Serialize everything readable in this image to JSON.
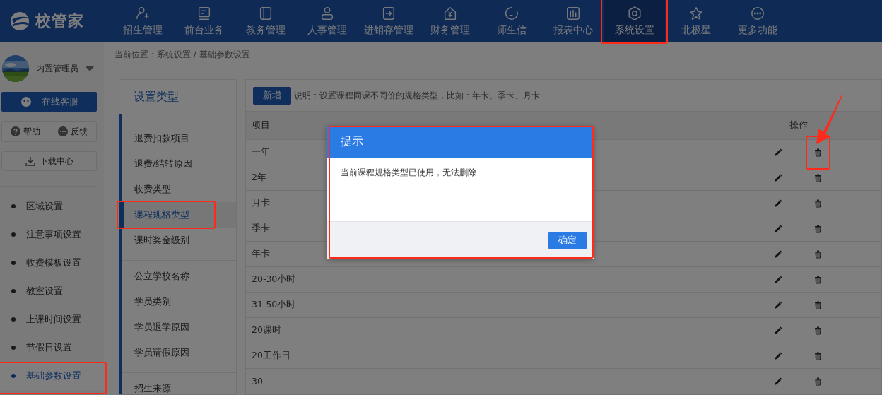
{
  "logo": {
    "text": "校管家"
  },
  "nav": [
    {
      "label": "招生管理",
      "selected": false,
      "highlighted": false
    },
    {
      "label": "前台业务",
      "selected": false,
      "highlighted": false
    },
    {
      "label": "教务管理",
      "selected": false,
      "highlighted": false
    },
    {
      "label": "人事管理",
      "selected": false,
      "highlighted": false
    },
    {
      "label": "进销存管理",
      "selected": false,
      "highlighted": false
    },
    {
      "label": "财务管理",
      "selected": false,
      "highlighted": false
    },
    {
      "label": "师生信",
      "selected": false,
      "highlighted": false
    },
    {
      "label": "报表中心",
      "selected": false,
      "highlighted": false
    },
    {
      "label": "系统设置",
      "selected": true,
      "highlighted": true
    },
    {
      "label": "北极星",
      "selected": false,
      "highlighted": false
    },
    {
      "label": "更多功能",
      "selected": false,
      "highlighted": false
    }
  ],
  "breadcrumb": "当前位置：系统设置 / 基础参数设置",
  "user": {
    "name": "内置管理员"
  },
  "sidebar": {
    "service_button": "在线客服",
    "help": "帮助",
    "feedback": "反馈",
    "download": "下载中心",
    "items": [
      {
        "label": "区域设置",
        "selected": false,
        "highlighted": false
      },
      {
        "label": "注意事项设置",
        "selected": false,
        "highlighted": false
      },
      {
        "label": "收费模板设置",
        "selected": false,
        "highlighted": false
      },
      {
        "label": "教室设置",
        "selected": false,
        "highlighted": false
      },
      {
        "label": "上课时间设置",
        "selected": false,
        "highlighted": false
      },
      {
        "label": "节假日设置",
        "selected": false,
        "highlighted": false
      },
      {
        "label": "基础参数设置",
        "selected": true,
        "highlighted": true
      }
    ]
  },
  "settings_types": {
    "title": "设置类型",
    "groups": [
      {
        "items": [
          {
            "label": "退费扣款项目",
            "selected": false,
            "highlighted": false
          },
          {
            "label": "退费/结转原因",
            "selected": false,
            "highlighted": false
          },
          {
            "label": "收费类型",
            "selected": false,
            "highlighted": false
          },
          {
            "label": "课程规格类型",
            "selected": true,
            "highlighted": true
          },
          {
            "label": "课时奖金级别",
            "selected": false,
            "highlighted": false
          }
        ]
      },
      {
        "items": [
          {
            "label": "公立学校名称",
            "selected": false,
            "highlighted": false
          },
          {
            "label": "学员类别",
            "selected": false,
            "highlighted": false
          },
          {
            "label": "学员退学原因",
            "selected": false,
            "highlighted": false
          },
          {
            "label": "学员请假原因",
            "selected": false,
            "highlighted": false
          }
        ]
      },
      {
        "items": [
          {
            "label": "招生来源",
            "selected": false,
            "highlighted": false
          }
        ]
      }
    ]
  },
  "toolbar": {
    "add_button": "新增",
    "note": "说明：设置课程同课不同价的规格类型，比如：年卡、季卡、月卡"
  },
  "table": {
    "columns": [
      {
        "label": "项目"
      },
      {
        "label": "操作"
      }
    ],
    "rows": [
      {
        "item": "一年",
        "delete_highlighted": true
      },
      {
        "item": "2年",
        "delete_highlighted": false
      },
      {
        "item": "月卡",
        "delete_highlighted": false
      },
      {
        "item": "季卡",
        "delete_highlighted": false
      },
      {
        "item": "年卡",
        "delete_highlighted": false
      },
      {
        "item": "20-30小时",
        "delete_highlighted": false
      },
      {
        "item": "31-50小时",
        "delete_highlighted": false
      },
      {
        "item": "20课时",
        "delete_highlighted": false
      },
      {
        "item": "20工作日",
        "delete_highlighted": false
      },
      {
        "item": "30",
        "delete_highlighted": false
      }
    ]
  },
  "dialog": {
    "title": "提示",
    "message": "当前课程规格类型已使用，无法删除",
    "confirm_button": "确定",
    "highlighted": true
  }
}
